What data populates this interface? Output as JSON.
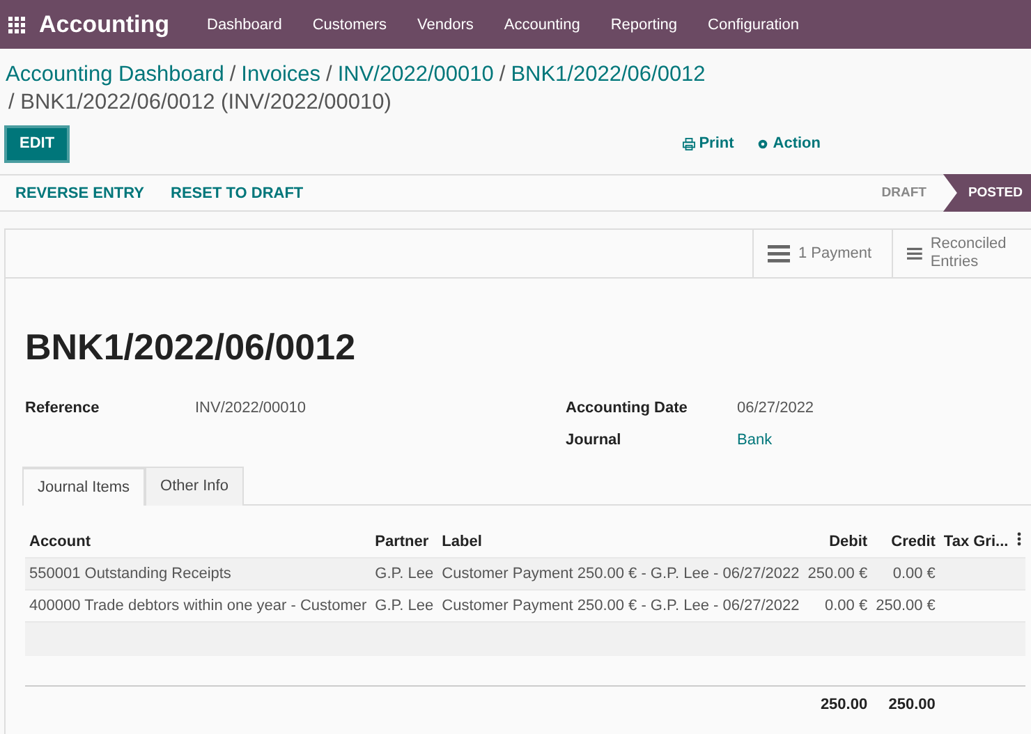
{
  "navbar": {
    "app": "Accounting",
    "menu": [
      "Dashboard",
      "Customers",
      "Vendors",
      "Accounting",
      "Reporting",
      "Configuration"
    ]
  },
  "breadcrumbs": [
    "Accounting Dashboard",
    "Invoices",
    "INV/2022/00010",
    "BNK1/2022/06/0012"
  ],
  "separator": "/",
  "current": "/ BNK1/2022/06/0012 (INV/2022/00010)",
  "edit_button": "EDIT",
  "actions": [
    "Print",
    "Action"
  ],
  "status_buttons": [
    "REVERSE ENTRY",
    "RESET TO DRAFT"
  ],
  "stages": [
    {
      "label": "DRAFT",
      "selected": false
    },
    {
      "label": "POSTED",
      "selected": true
    }
  ],
  "smart_buttons": [
    "1 Payment",
    "Reconciled Entries"
  ],
  "title": "BNK1/2022/06/0012",
  "fields_left": [
    {
      "label": "Reference",
      "value": "INV/2022/00010",
      "link": false
    }
  ],
  "fields_right": [
    {
      "label": "Accounting Date",
      "value": "06/27/2022",
      "link": false
    },
    {
      "label": "Journal",
      "value": "Bank",
      "link": true
    }
  ],
  "tabs": [
    {
      "label": "Journal Items",
      "selected": true
    },
    {
      "label": "Other Info",
      "selected": false
    }
  ],
  "table": {
    "columns": [
      "Account",
      "Partner",
      "Label",
      "Debit",
      "Credit",
      "Tax Gri..."
    ],
    "rows": [
      [
        "550001 Outstanding Receipts",
        "G.P. Lee",
        "Customer Payment 250.00 € - G.P. Lee - 06/27/2022",
        "250.00 €",
        "0.00 €"
      ],
      [
        "400000 Trade debtors within one year - Customer",
        "G.P. Lee",
        "Customer Payment 250.00 € - G.P. Lee - 06/27/2022",
        "0.00 €",
        "250.00 €"
      ]
    ],
    "totals": [
      "250.00",
      "250.00"
    ]
  }
}
